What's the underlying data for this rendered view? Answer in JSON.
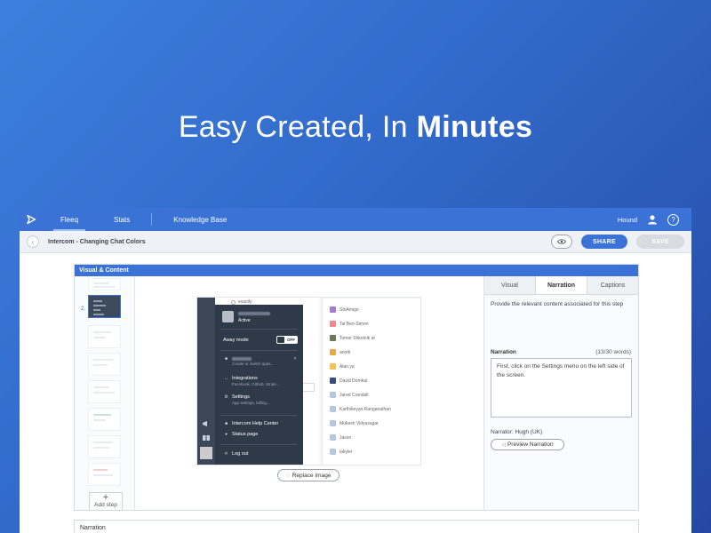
{
  "hero": {
    "headline_light": "Easy Created, In ",
    "headline_bold": "Minutes"
  },
  "topbar": {
    "nav": [
      {
        "label": "Fleeq",
        "active": true
      },
      {
        "label": "Stats",
        "active": false
      },
      {
        "label": "Knowledge Base",
        "active": false
      }
    ],
    "user_name": "Hound",
    "help_icon": "?"
  },
  "subbar": {
    "back_icon": "‹",
    "title": "Intercom - Changing Chat Colors",
    "share_label": "SHARE",
    "save_label": "SAVE"
  },
  "editor": {
    "section_title": "Visual & Content",
    "active_step_number": "2.",
    "add_step_icon": "+",
    "add_step_label": "Add step",
    "replace_image_label": "Replace Image",
    "screenshot": {
      "top_item": "exactly",
      "profile_status": "Active",
      "away_mode": "Away mode",
      "away_toggle": "OFF",
      "menu": [
        {
          "label": "Integrations",
          "sub": "Facebook, Github, Stripe...",
          "icon": "↔"
        },
        {
          "label": "Settings",
          "sub": "App settings, billing...",
          "icon": "⚙"
        },
        {
          "label": "Intercom Help Center",
          "sub": "",
          "icon": "■"
        },
        {
          "label": "Status page",
          "sub": "",
          "icon": "●"
        },
        {
          "label": "Log out",
          "sub": "",
          "icon": "✕"
        }
      ],
      "app_switch_sub": "Create or switch apps...",
      "people": [
        {
          "name": "StoAmigo",
          "color": "#a77ad6"
        },
        {
          "name": "Tal Ben-Simon",
          "color": "#f08a8a"
        },
        {
          "name": "Tomer Shkolnik at",
          "color": "#6b7b5a"
        },
        {
          "name": "anotti",
          "color": "#e8a94c"
        },
        {
          "name": "Alan.ya",
          "color": "#f2c14e"
        },
        {
          "name": "David Domkal",
          "color": "#3b4a7c"
        },
        {
          "name": "Jared Crandall",
          "color": "#b8c7e0"
        },
        {
          "name": "Karthikeyan Ranganathan",
          "color": "#b8c7e0"
        },
        {
          "name": "Mukesh Vidyasagar",
          "color": "#b8c7e0"
        },
        {
          "name": "Jason",
          "color": "#b8c7e0"
        },
        {
          "name": "lakyler",
          "color": "#b8c7e0"
        }
      ]
    }
  },
  "panel": {
    "tabs": [
      {
        "label": "Visual",
        "active": false
      },
      {
        "label": "Narration",
        "active": true
      },
      {
        "label": "Captions",
        "active": false
      }
    ],
    "description": "Provide the relevant content associated for this step",
    "narration_label": "Narration",
    "narration_count": "(13/30 words)",
    "narration_text": "First, click on the Settings menu on the left side of the screen.",
    "narrator": "Narrator: Hugh (UK)",
    "preview_label": "Preview Narration"
  },
  "bottom": {
    "label": "Narration"
  },
  "colors": {
    "brand_blue": "#3a72d6",
    "dark_menu": "#2f3a49"
  },
  "icons": [
    "fleeq-logo-icon",
    "user-icon",
    "help-icon",
    "back-icon",
    "eye-icon",
    "refresh-icon",
    "speaker-icon"
  ]
}
